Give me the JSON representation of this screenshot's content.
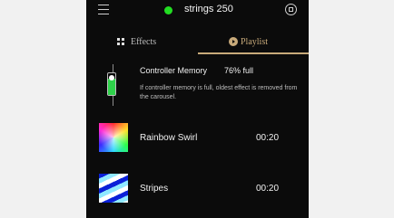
{
  "header": {
    "menu_icon": "hamburger-menu-icon",
    "status_color": "#22dd22",
    "device_name": "strings 250",
    "stop_icon": "stop-circle-icon"
  },
  "tabs": [
    {
      "label": "Effects",
      "icon": "grid-icon",
      "active": false
    },
    {
      "label": "Playlist",
      "icon": "play-circle-icon",
      "active": true
    }
  ],
  "memory": {
    "title": "Controller Memory",
    "percent_text": "76% full",
    "fill_fraction": 0.76,
    "note": "If controller memory is full, oldest effect is removed from the carousel.",
    "fill_color": "#2ed14a"
  },
  "playlist": [
    {
      "name": "Rainbow Swirl",
      "duration": "00:20",
      "thumbnail": "rainbow-swirl"
    },
    {
      "name": "Stripes",
      "duration": "00:20",
      "thumbnail": "blue-white-stripes"
    }
  ],
  "colors": {
    "background": "#0b0b0b",
    "accent": "#c8aa7a",
    "page": "#f1f1f1"
  }
}
